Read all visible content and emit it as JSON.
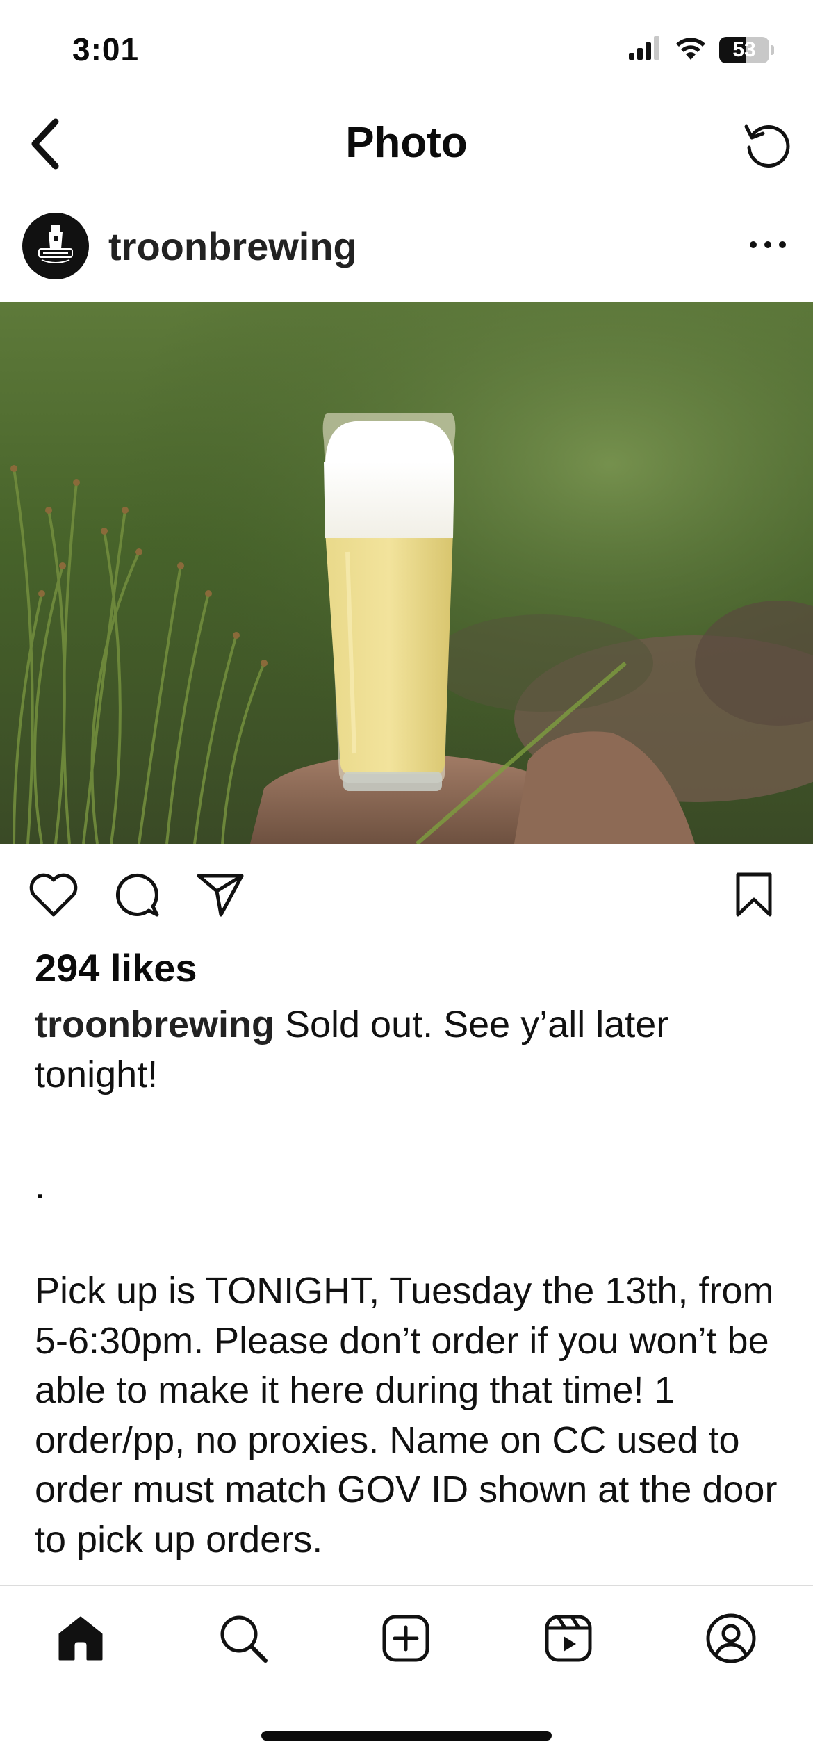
{
  "status_bar": {
    "time": "3:01",
    "battery_level": "53",
    "battery_fraction": 0.53,
    "icons": [
      "cellular-signal-icon",
      "wifi-icon",
      "battery-icon"
    ]
  },
  "nav": {
    "title": "Photo",
    "back_icon": "chevron-left-icon",
    "refresh_icon": "refresh-icon"
  },
  "post": {
    "username": "troonbrewing",
    "avatar_icon": "troon-brewing-logo",
    "more_icon": "more-horizontal-icon",
    "photo_description_icon": "beer-glass-photo",
    "likes": "294 likes",
    "caption_user": "troonbrewing",
    "caption_text": " Sold out. See y’all later tonight!",
    "caption_dot": ".",
    "caption_body": "Pick up is TONIGHT, Tuesday the 13th, from 5-6:30pm. Please don’t order if you won’t be able to make it here during that time! 1 order/pp, no proxies. Name on CC used to order must match GOV ID shown at the door to pick up orders."
  },
  "actions": {
    "icons": [
      "heart-icon",
      "comment-icon",
      "share-icon",
      "bookmark-icon"
    ]
  },
  "tab_bar": {
    "icons": [
      "home-icon",
      "search-icon",
      "create-icon",
      "reels-icon",
      "profile-icon"
    ],
    "active": "home-icon"
  },
  "colors": {
    "text": "#0b0b0b",
    "background": "#ffffff",
    "divider": "#dcdcdc"
  }
}
